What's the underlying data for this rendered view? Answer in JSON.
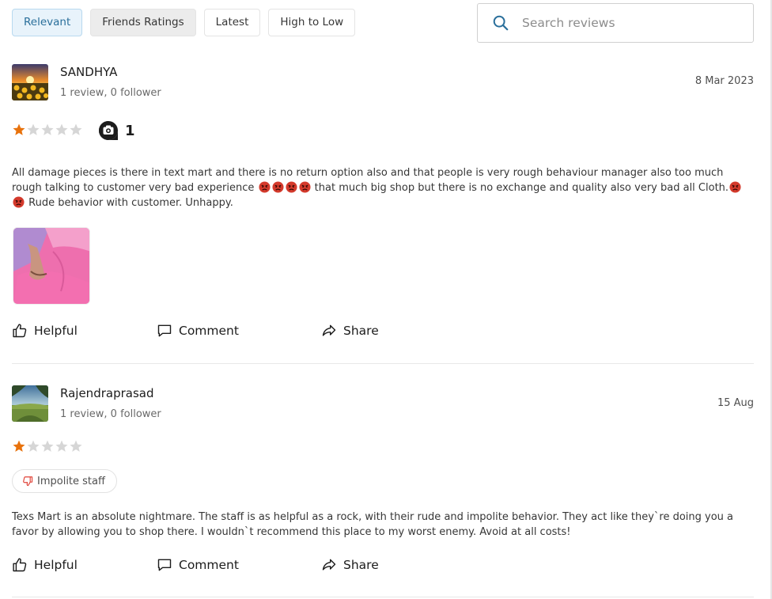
{
  "filters": [
    {
      "label": "Relevant",
      "active": true
    },
    {
      "label": "Friends Ratings",
      "active": false
    },
    {
      "label": "Latest",
      "active": false
    },
    {
      "label": "High to Low",
      "active": false
    }
  ],
  "search": {
    "placeholder": "Search reviews",
    "value": ""
  },
  "colors": {
    "accent": "#2a6f9b",
    "star_filled": "#e8720c",
    "star_empty": "#d6d6d6",
    "complaint": "#e0443a"
  },
  "reviews": [
    {
      "name": "SANDHYA",
      "meta": "1 review, 0 follower",
      "date": "8 Mar 2023",
      "rating": 1,
      "photo_count": "1",
      "text_1": "All damage pieces is there in text mart and there is no return option also and that people is very rough behaviour manager also too much rough talking to customer very bad experience",
      "text_2": "that much big shop but there is no exchange and quality also very bad all Cloth.",
      "text_3": "Rude behavior with customer. Unhappy.",
      "emoji_icon": "angry-face-icon",
      "actions": {
        "helpful": "Helpful",
        "comment": "Comment",
        "share": "Share"
      }
    },
    {
      "name": "Rajendraprasad",
      "meta": "1 review, 0 follower",
      "date": "15 Aug",
      "rating": 1,
      "tag": "Impolite staff",
      "text": "Texs Mart is an absolute nightmare. The staff is as helpful as a rock, with their rude and impolite behavior. They act like they`re doing you a favor by allowing you to shop there. I wouldn`t recommend this place to my worst enemy. Avoid at all costs!",
      "actions": {
        "helpful": "Helpful",
        "comment": "Comment",
        "share": "Share"
      }
    }
  ]
}
